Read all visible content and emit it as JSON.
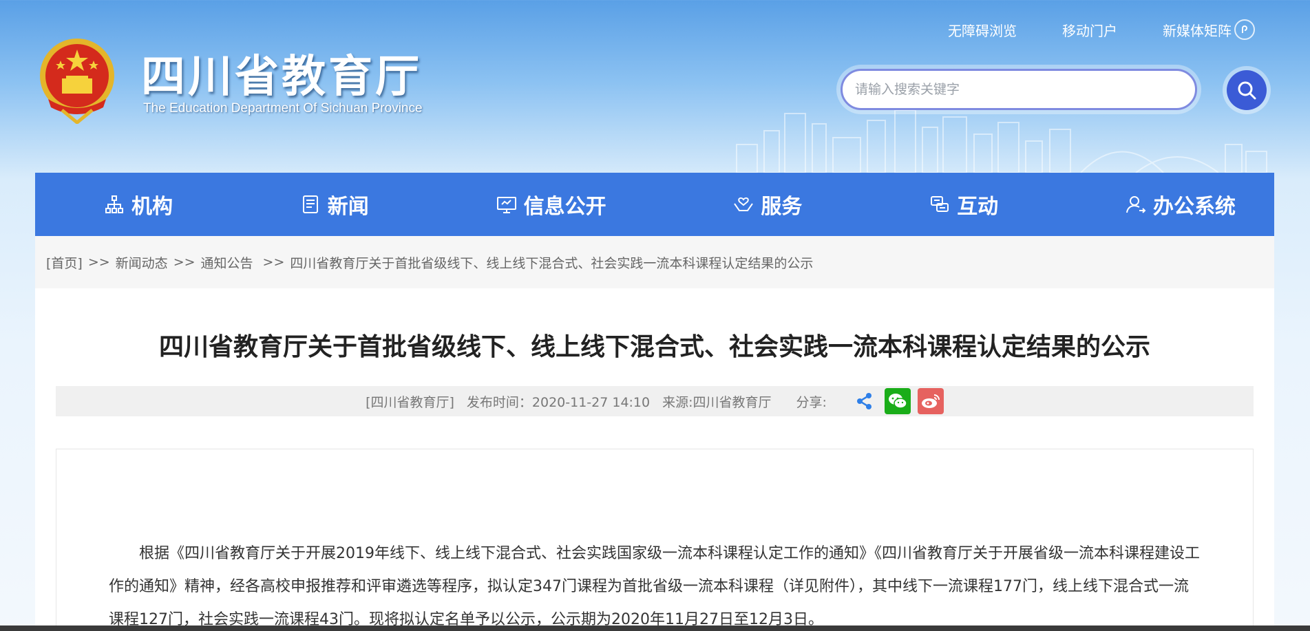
{
  "header": {
    "site_title": "四川省教育厅",
    "site_subtitle": "The Education Department Of Sichuan Province",
    "top_links": {
      "accessibility": "无障碍浏览",
      "mobile": "移动门户",
      "new_media": "新媒体矩阵"
    },
    "search": {
      "placeholder": "请输入搜索关键字"
    }
  },
  "nav": {
    "items": [
      {
        "label": "机构",
        "icon": "org-chart-icon"
      },
      {
        "label": "新闻",
        "icon": "news-icon"
      },
      {
        "label": "信息公开",
        "icon": "monitor-icon"
      },
      {
        "label": "服务",
        "icon": "hands-icon"
      },
      {
        "label": "互动",
        "icon": "chat-icon"
      },
      {
        "label": "办公系统",
        "icon": "user-office-icon"
      }
    ]
  },
  "breadcrumb": {
    "home": "[首页]",
    "sep": ">>",
    "level1": "新闻动态",
    "level2": "通知公告",
    "current": "四川省教育厅关于首批省级线下、线上线下混合式、社会实践一流本科课程认定结果的公示"
  },
  "article": {
    "title": "四川省教育厅关于首批省级线下、线上线下混合式、社会实践一流本科课程认定结果的公示",
    "meta": {
      "department": "[四川省教育厅]",
      "publish_time": "发布时间：2020-11-27 14:10",
      "source": "来源:四川省教育厅",
      "share_label": "分享:"
    },
    "paragraph": "根据《四川省教育厅关于开展2019年线下、线上线下混合式、社会实践国家级一流本科课程认定工作的通知》《四川省教育厅关于开展省级一流本科课程建设工作的通知》精神，经各高校申报推荐和评审遴选等程序，拟认定347门课程为首批省级一流本科课程（详见附件），其中线下一流课程177门，线上线下混合式一流课程127门，社会实践一流课程43门。现将拟认定名单予以公示，公示期为2020年11月27日至12月3日。"
  },
  "colors": {
    "nav_bg": "#3b78e0",
    "search_btn": "#3b5bd6",
    "wechat": "#1aad19",
    "weibo": "#e6625f",
    "share": "#2e7fe8"
  }
}
